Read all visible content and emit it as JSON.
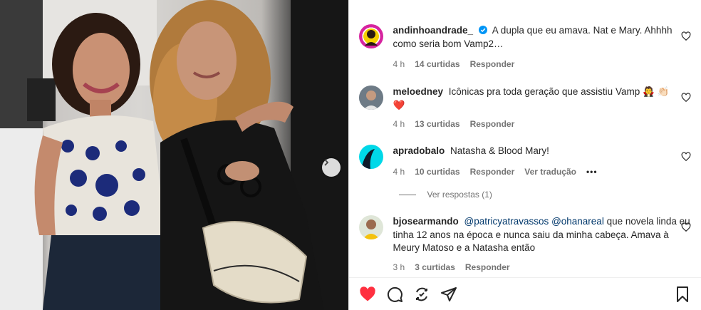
{
  "post": {
    "caption_user": "andinhoandrade_",
    "caption_text": "A dupla que eu amava. Nat e Mary. Ahhhh como seria bom Vamp2…",
    "caption_time": "4 h",
    "caption_likes": "14 curtidas",
    "caption_reply": "Responder"
  },
  "comments": [
    {
      "user": "meloedney",
      "text": "Icônicas pra toda geração que assistiu Vamp 🧛 👏🏻",
      "text_line2": "❤️",
      "time": "4 h",
      "likes": "13 curtidas",
      "reply": "Responder"
    },
    {
      "user": "apradobalo",
      "text": "Natasha & Blood Mary!",
      "time": "4 h",
      "likes": "10 curtidas",
      "reply": "Responder",
      "translate": "Ver tradução",
      "more": "•••"
    },
    {
      "user": "bjosearmando",
      "mention1": "@patricyatravassos",
      "mention2": "@ohanareal",
      "text": " que novela linda eu tinha 12 anos na época e nunca saiu da minha cabeça. Amava à Meury Matoso e a Natasha então",
      "time": "3 h",
      "likes": "3 curtidas",
      "reply": "Responder"
    }
  ],
  "view_replies": "Ver respostas (1)",
  "colors": {
    "like_red": "#ff3040",
    "verified_blue": "#0095f6",
    "link": "#00376b",
    "meta_gray": "#737373"
  },
  "icons": [
    "heart-filled-icon",
    "comment-icon",
    "share-icon",
    "send-icon",
    "bookmark-icon",
    "heart-outline-icon",
    "verified-icon",
    "chevron-right-icon"
  ]
}
